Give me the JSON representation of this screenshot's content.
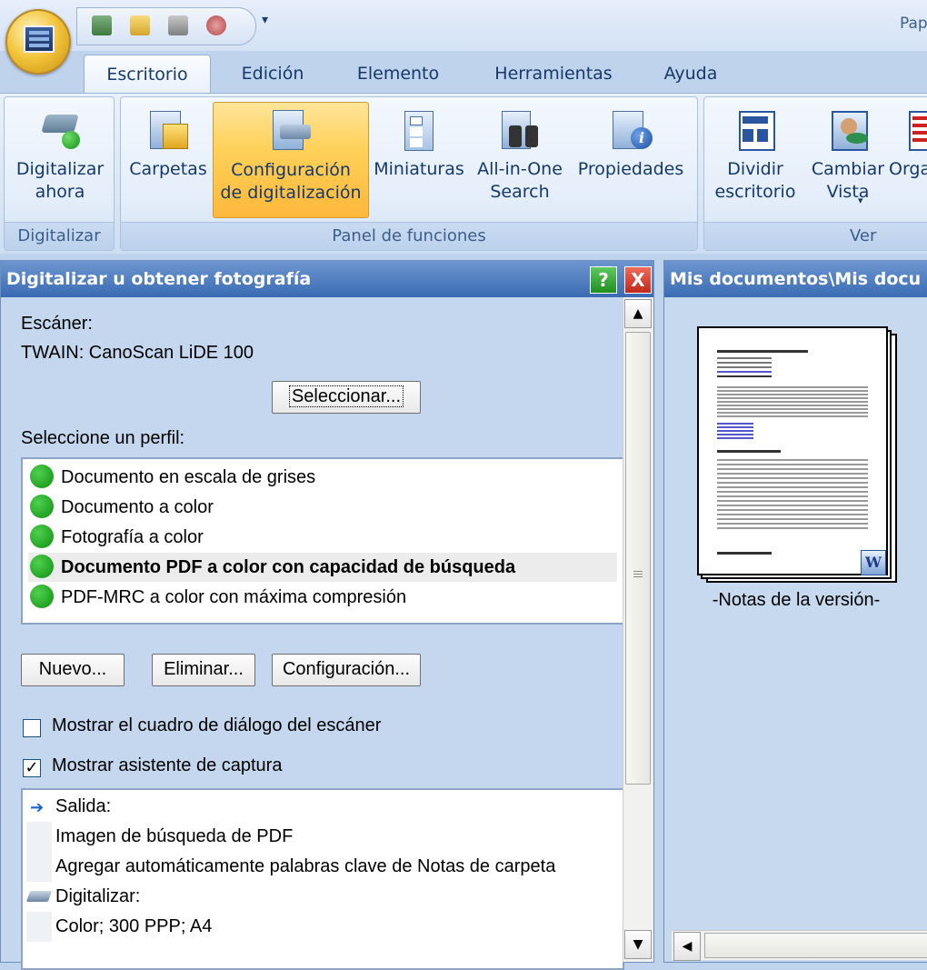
{
  "app": {
    "title_fragment": "Pap"
  },
  "tabs": [
    "Escritorio",
    "Edición",
    "Elemento",
    "Herramientas",
    "Ayuda"
  ],
  "ribbon": {
    "scan_now": "Digitalizar ahora",
    "group_digitalizar": "Digitalizar",
    "folders": "Carpetas",
    "scan_settings": "Configuración de digitalización",
    "thumbnails": "Miniaturas",
    "aio_search": "All-in-One Search",
    "properties": "Propiedades",
    "group_panel": "Panel de funciones",
    "split_desktop": "Dividir escritorio",
    "change_view": "Cambiar Vista",
    "organize": "Orga",
    "group_view": "Ver"
  },
  "scan_panel": {
    "title": "Digitalizar u obtener fotografía",
    "help": "?",
    "close": "X",
    "scanner_label": "Escáner:",
    "scanner_value": "TWAIN: CanoScan LiDE 100",
    "select_button": "Seleccionar...",
    "profile_label": "Seleccione un perfil:",
    "profiles": [
      "Documento en escala de grises",
      "Documento a color",
      "Fotografía a color",
      "Documento PDF a color con capacidad de búsqueda",
      "PDF-MRC a color con máxima compresión"
    ],
    "selected_profile_index": 3,
    "new_button": "Nuevo...",
    "delete_button": "Eliminar...",
    "config_button": "Configuración...",
    "show_scanner_dialog": "Mostrar el cuadro de diálogo del escáner",
    "show_scanner_dialog_checked": false,
    "show_capture_wizard": "Mostrar asistente de captura",
    "show_capture_wizard_checked": true,
    "summary": [
      {
        "icon": "arrow-right-icon",
        "text": "Salida:"
      },
      {
        "icon": "",
        "text": "Imagen de búsqueda de PDF"
      },
      {
        "icon": "",
        "text": "Agregar automáticamente palabras clave de Notas de carpeta"
      },
      {
        "icon": "scanner-icon",
        "text": "Digitalizar:"
      },
      {
        "icon": "",
        "text": "Color; 300 PPP; A4"
      }
    ]
  },
  "doc_panel": {
    "title": "Mis documentos\\Mis docu",
    "thumbnail_caption": "-Notas de la versión-"
  }
}
